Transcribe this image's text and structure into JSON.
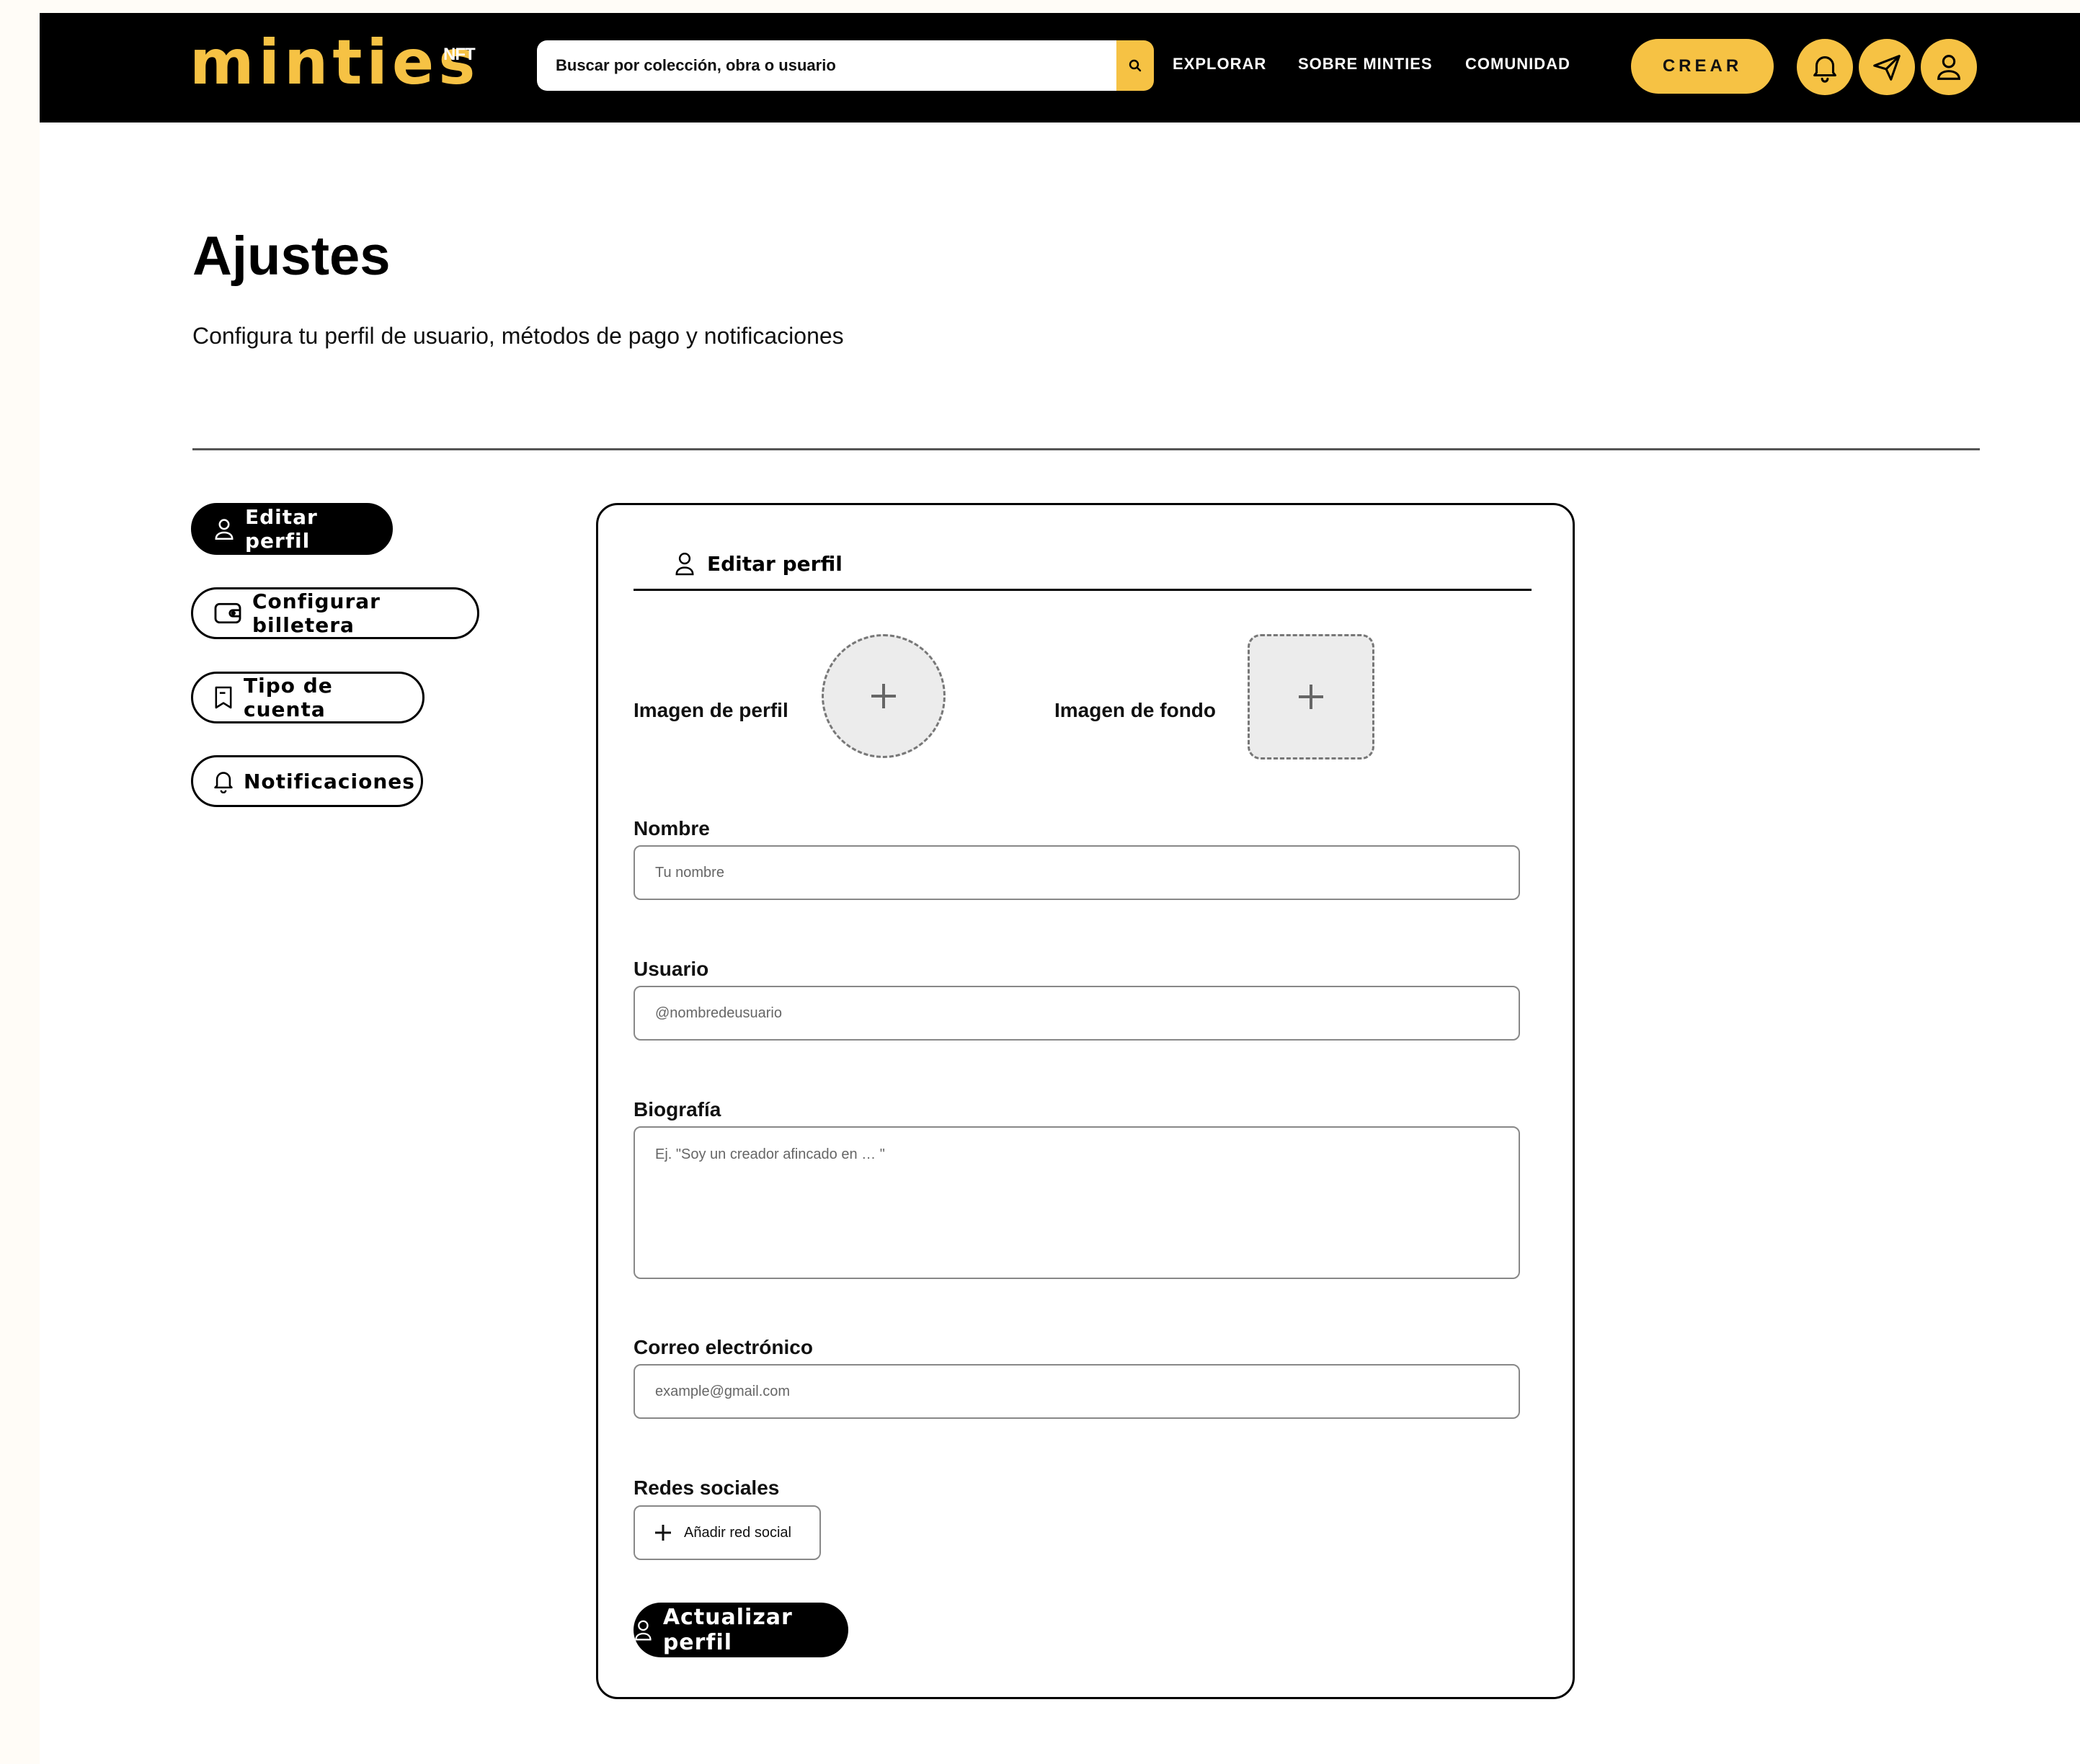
{
  "brand": {
    "logo": "minties",
    "logo_sup": "NFT",
    "accent": "#f6c244"
  },
  "search": {
    "placeholder": "Buscar por colección, obra o usuario"
  },
  "nav": {
    "links": [
      "EXPLORAR",
      "SOBRE MINTIES",
      "COMUNIDAD"
    ],
    "create": "CREAR"
  },
  "header_icons": [
    "bell-icon",
    "send-icon",
    "user-icon"
  ],
  "page": {
    "title": "Ajustes",
    "subtitle": "Configura tu perfil de usuario, métodos de pago y notificaciones"
  },
  "sidebar": {
    "items": [
      {
        "label": "Editar perfil",
        "icon": "user-icon",
        "active": true
      },
      {
        "label": "Configurar billetera",
        "icon": "wallet-icon",
        "active": false
      },
      {
        "label": "Tipo de cuenta",
        "icon": "bookmark-icon",
        "active": false
      },
      {
        "label": "Notificaciones",
        "icon": "bell-icon",
        "active": false
      }
    ]
  },
  "form": {
    "heading": "Editar perfil",
    "profile_image_label": "Imagen de perfil",
    "background_image_label": "Imagen de fondo",
    "name_label": "Nombre",
    "name_placeholder": "Tu nombre",
    "username_label": "Usuario",
    "username_placeholder": "@nombredeusuario",
    "bio_label": "Biografía",
    "bio_placeholder": "Ej. \"Soy un creador afincado en … \"",
    "email_label": "Correo electrónico",
    "email_placeholder": "example@gmail.com",
    "social_label": "Redes sociales",
    "add_social": "Añadir red social",
    "submit": "Actualizar perfil"
  }
}
